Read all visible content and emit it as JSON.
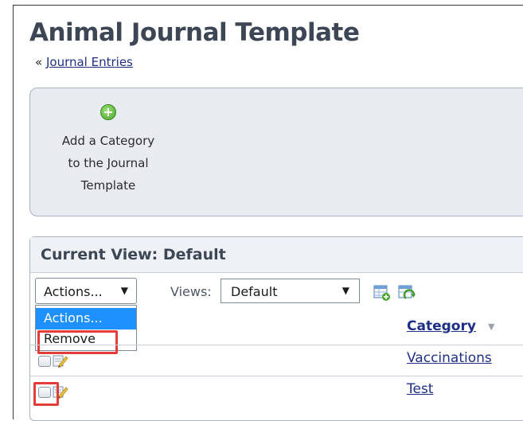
{
  "page": {
    "title": "Animal Journal Template",
    "breadcrumb_prefix": "«",
    "breadcrumb_link": "Journal Entries"
  },
  "action_panel": {
    "add_category_label_line1": "Add a Category",
    "add_category_label_line2": "to the Journal",
    "add_category_label_line3": "Template",
    "add_icon": "plus-circle-icon"
  },
  "view_panel": {
    "current_view_label": "Current View: Default",
    "actions_select_value": "Actions...",
    "actions_options": [
      "Actions...",
      "Remove"
    ],
    "views_label": "Views:",
    "views_select_value": "Default",
    "toolbar_icons": [
      "grid-add-icon",
      "grid-refresh-icon"
    ]
  },
  "table": {
    "column_header": "Category",
    "sort_indicator": "▼",
    "rows": [
      {
        "category": "Vaccinations"
      },
      {
        "category": "Test"
      }
    ]
  },
  "colors": {
    "title": "#3d4654",
    "link": "#1f2f86",
    "highlight": "#e43b3b",
    "selected_option": "#1e90ff"
  }
}
